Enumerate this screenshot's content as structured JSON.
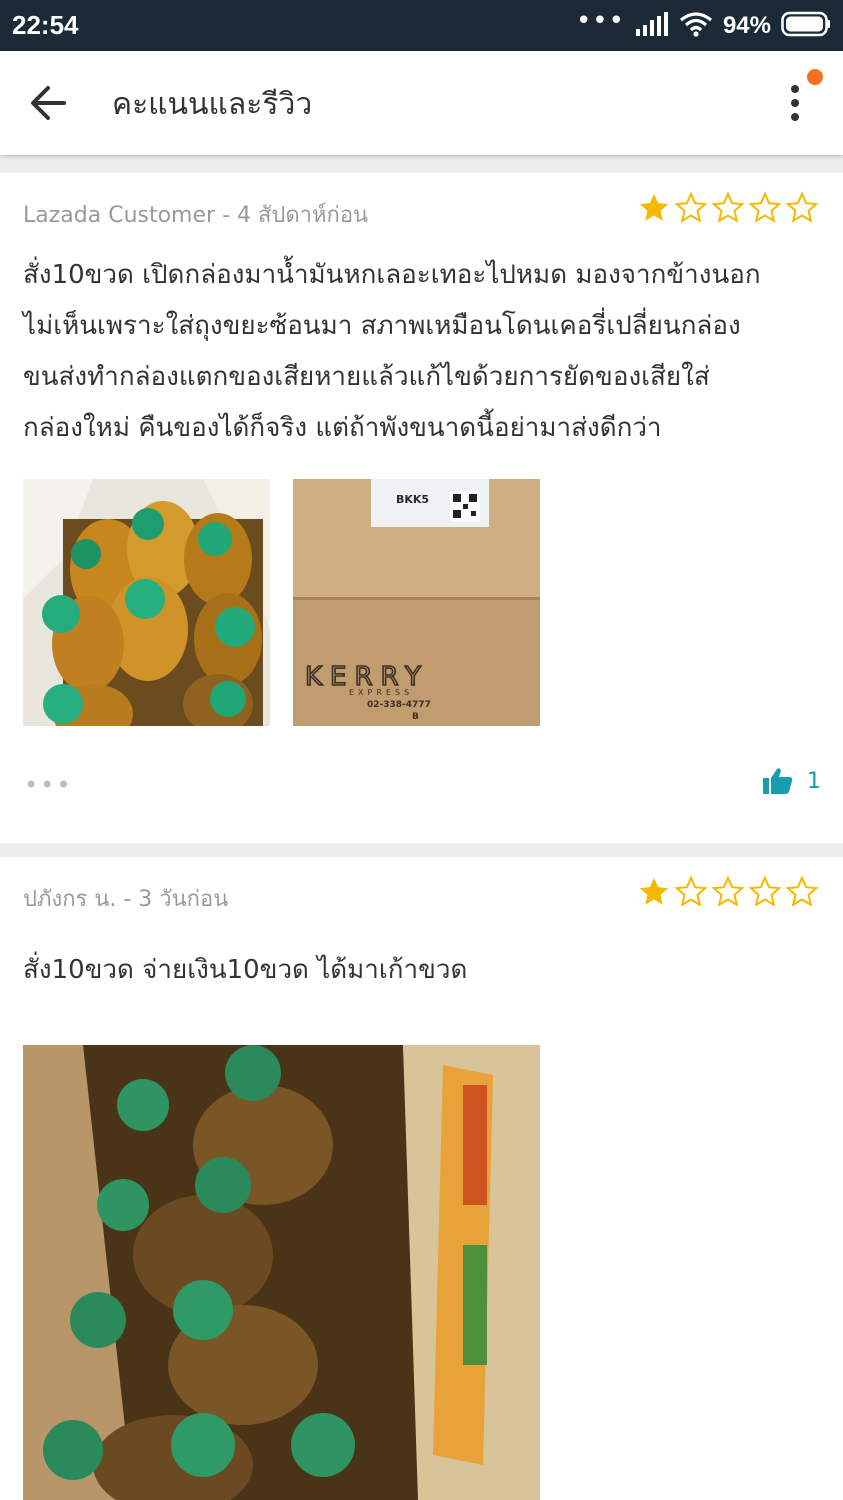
{
  "status_bar": {
    "time": "22:54",
    "signal_dots": "•••",
    "battery_percent": "94%"
  },
  "header": {
    "title": "คะแนนและรีวิว",
    "back_icon": "arrow-left-icon",
    "menu_icon": "more-vertical-icon",
    "notification_dot_color": "#f36f21"
  },
  "colors": {
    "star_filled": "#f5b800",
    "star_empty_stroke": "#f5b800",
    "accent": "#1a9cb0",
    "status_bar_bg": "#1c2a38"
  },
  "reviews": [
    {
      "author_line": "Lazada Customer - 4 สัปดาห์ก่อน",
      "rating": 1,
      "max_rating": 5,
      "text_lines": [
        "สั่ง10ขวด เปิดกล่องมาน้ำมันหกเลอะเทอะไปหมด มองจากข้างนอก",
        "ไม่เห็นเพราะใส่ถุงขยะซ้อนมา สภาพเหมือนโดนเคอรี่เปลี่ยนกล่อง",
        "ขนส่งทำกล่องแตกของเสียหายแล้วแก้ไขด้วยการยัดของเสียใส่",
        "กล่องใหม่ คืนของได้ก็จริง แต่ถ้าพังขนาดนี้อย่ามาส่งดีกว่า"
      ],
      "photos": [
        {
          "description_icon": "oil-bottles-in-bag-photo"
        },
        {
          "description_icon": "kerry-box-photo",
          "label_code": "BKK5",
          "box_brand": "KERRY",
          "box_sub": "EXPRESS",
          "box_phone": "02-338-4777",
          "box_letter": "B"
        }
      ],
      "more_label": "•••",
      "like_icon": "thumbs-up-icon",
      "like_count": "1"
    },
    {
      "author_line": "ปภังกร น. - 3 วันก่อน",
      "rating": 1,
      "max_rating": 5,
      "text_lines": [
        "สั่ง10ขวด จ่ายเงิน10ขวด ได้มาเก้าขวด"
      ],
      "photos": [
        {
          "description_icon": "oil-bottles-in-box-photo"
        }
      ]
    }
  ]
}
